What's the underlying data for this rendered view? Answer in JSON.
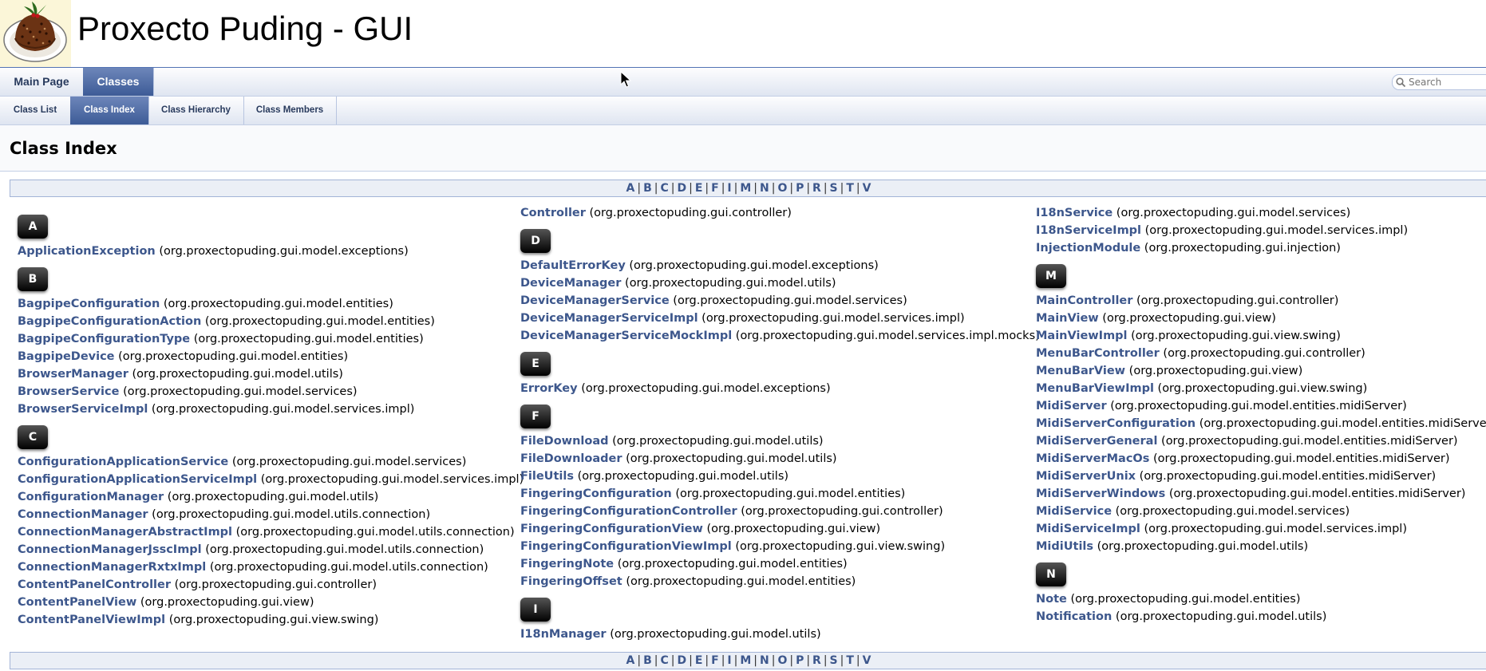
{
  "project": {
    "name": "Proxecto Puding - GUI"
  },
  "nav": {
    "tabs": [
      {
        "label": "Main Page",
        "active": false
      },
      {
        "label": "Classes",
        "active": true
      }
    ],
    "subtabs": [
      {
        "label": "Class List",
        "active": false
      },
      {
        "label": "Class Index",
        "active": true
      },
      {
        "label": "Class Hierarchy",
        "active": false
      },
      {
        "label": "Class Members",
        "active": false
      }
    ],
    "search_placeholder": "Search"
  },
  "page": {
    "title": "Class Index"
  },
  "letters_index": [
    "A",
    "B",
    "C",
    "D",
    "E",
    "F",
    "I",
    "M",
    "N",
    "O",
    "P",
    "R",
    "S",
    "T",
    "V"
  ],
  "columns": [
    [
      {
        "type": "letter",
        "text": "A"
      },
      {
        "type": "entry",
        "name": "ApplicationException",
        "pkg": "(org.proxectopuding.gui.model.exceptions)"
      },
      {
        "type": "letter",
        "text": "B"
      },
      {
        "type": "entry",
        "name": "BagpipeConfiguration",
        "pkg": "(org.proxectopuding.gui.model.entities)"
      },
      {
        "type": "entry",
        "name": "BagpipeConfigurationAction",
        "pkg": "(org.proxectopuding.gui.model.entities)"
      },
      {
        "type": "entry",
        "name": "BagpipeConfigurationType",
        "pkg": "(org.proxectopuding.gui.model.entities)"
      },
      {
        "type": "entry",
        "name": "BagpipeDevice",
        "pkg": "(org.proxectopuding.gui.model.entities)"
      },
      {
        "type": "entry",
        "name": "BrowserManager",
        "pkg": "(org.proxectopuding.gui.model.utils)"
      },
      {
        "type": "entry",
        "name": "BrowserService",
        "pkg": "(org.proxectopuding.gui.model.services)"
      },
      {
        "type": "entry",
        "name": "BrowserServiceImpl",
        "pkg": "(org.proxectopuding.gui.model.services.impl)"
      },
      {
        "type": "letter",
        "text": "C"
      },
      {
        "type": "entry",
        "name": "ConfigurationApplicationService",
        "pkg": "(org.proxectopuding.gui.model.services)"
      },
      {
        "type": "entry",
        "name": "ConfigurationApplicationServiceImpl",
        "pkg": "(org.proxectopuding.gui.model.services.impl)"
      },
      {
        "type": "entry",
        "name": "ConfigurationManager",
        "pkg": "(org.proxectopuding.gui.model.utils)"
      },
      {
        "type": "entry",
        "name": "ConnectionManager",
        "pkg": "(org.proxectopuding.gui.model.utils.connection)"
      },
      {
        "type": "entry",
        "name": "ConnectionManagerAbstractImpl",
        "pkg": "(org.proxectopuding.gui.model.utils.connection)"
      },
      {
        "type": "entry",
        "name": "ConnectionManagerJsscImpl",
        "pkg": "(org.proxectopuding.gui.model.utils.connection)"
      },
      {
        "type": "entry",
        "name": "ConnectionManagerRxtxImpl",
        "pkg": "(org.proxectopuding.gui.model.utils.connection)"
      },
      {
        "type": "entry",
        "name": "ContentPanelController",
        "pkg": "(org.proxectopuding.gui.controller)"
      },
      {
        "type": "entry",
        "name": "ContentPanelView",
        "pkg": "(org.proxectopuding.gui.view)"
      },
      {
        "type": "entry",
        "name": "ContentPanelViewImpl",
        "pkg": "(org.proxectopuding.gui.view.swing)"
      }
    ],
    [
      {
        "type": "entry",
        "name": "Controller",
        "pkg": "(org.proxectopuding.gui.controller)"
      },
      {
        "type": "letter",
        "text": "D"
      },
      {
        "type": "entry",
        "name": "DefaultErrorKey",
        "pkg": "(org.proxectopuding.gui.model.exceptions)"
      },
      {
        "type": "entry",
        "name": "DeviceManager",
        "pkg": "(org.proxectopuding.gui.model.utils)"
      },
      {
        "type": "entry",
        "name": "DeviceManagerService",
        "pkg": "(org.proxectopuding.gui.model.services)"
      },
      {
        "type": "entry",
        "name": "DeviceManagerServiceImpl",
        "pkg": "(org.proxectopuding.gui.model.services.impl)"
      },
      {
        "type": "entry",
        "name": "DeviceManagerServiceMockImpl",
        "pkg": "(org.proxectopuding.gui.model.services.impl.mocks)"
      },
      {
        "type": "letter",
        "text": "E"
      },
      {
        "type": "entry",
        "name": "ErrorKey",
        "pkg": "(org.proxectopuding.gui.model.exceptions)"
      },
      {
        "type": "letter",
        "text": "F"
      },
      {
        "type": "entry",
        "name": "FileDownload",
        "pkg": "(org.proxectopuding.gui.model.utils)"
      },
      {
        "type": "entry",
        "name": "FileDownloader",
        "pkg": "(org.proxectopuding.gui.model.utils)"
      },
      {
        "type": "entry",
        "name": "FileUtils",
        "pkg": "(org.proxectopuding.gui.model.utils)"
      },
      {
        "type": "entry",
        "name": "FingeringConfiguration",
        "pkg": "(org.proxectopuding.gui.model.entities)"
      },
      {
        "type": "entry",
        "name": "FingeringConfigurationController",
        "pkg": "(org.proxectopuding.gui.controller)"
      },
      {
        "type": "entry",
        "name": "FingeringConfigurationView",
        "pkg": "(org.proxectopuding.gui.view)"
      },
      {
        "type": "entry",
        "name": "FingeringConfigurationViewImpl",
        "pkg": "(org.proxectopuding.gui.view.swing)"
      },
      {
        "type": "entry",
        "name": "FingeringNote",
        "pkg": "(org.proxectopuding.gui.model.entities)"
      },
      {
        "type": "entry",
        "name": "FingeringOffset",
        "pkg": "(org.proxectopuding.gui.model.entities)"
      },
      {
        "type": "letter",
        "text": "I"
      },
      {
        "type": "entry",
        "name": "I18nManager",
        "pkg": "(org.proxectopuding.gui.model.utils)"
      }
    ],
    [
      {
        "type": "entry",
        "name": "I18nService",
        "pkg": "(org.proxectopuding.gui.model.services)"
      },
      {
        "type": "entry",
        "name": "I18nServiceImpl",
        "pkg": "(org.proxectopuding.gui.model.services.impl)"
      },
      {
        "type": "entry",
        "name": "InjectionModule",
        "pkg": "(org.proxectopuding.gui.injection)"
      },
      {
        "type": "letter",
        "text": "M"
      },
      {
        "type": "entry",
        "name": "MainController",
        "pkg": "(org.proxectopuding.gui.controller)"
      },
      {
        "type": "entry",
        "name": "MainView",
        "pkg": "(org.proxectopuding.gui.view)"
      },
      {
        "type": "entry",
        "name": "MainViewImpl",
        "pkg": "(org.proxectopuding.gui.view.swing)"
      },
      {
        "type": "entry",
        "name": "MenuBarController",
        "pkg": "(org.proxectopuding.gui.controller)"
      },
      {
        "type": "entry",
        "name": "MenuBarView",
        "pkg": "(org.proxectopuding.gui.view)"
      },
      {
        "type": "entry",
        "name": "MenuBarViewImpl",
        "pkg": "(org.proxectopuding.gui.view.swing)"
      },
      {
        "type": "entry",
        "name": "MidiServer",
        "pkg": "(org.proxectopuding.gui.model.entities.midiServer)"
      },
      {
        "type": "entry",
        "name": "MidiServerConfiguration",
        "pkg": "(org.proxectopuding.gui.model.entities.midiServer)"
      },
      {
        "type": "entry",
        "name": "MidiServerGeneral",
        "pkg": "(org.proxectopuding.gui.model.entities.midiServer)"
      },
      {
        "type": "entry",
        "name": "MidiServerMacOs",
        "pkg": "(org.proxectopuding.gui.model.entities.midiServer)"
      },
      {
        "type": "entry",
        "name": "MidiServerUnix",
        "pkg": "(org.proxectopuding.gui.model.entities.midiServer)"
      },
      {
        "type": "entry",
        "name": "MidiServerWindows",
        "pkg": "(org.proxectopuding.gui.model.entities.midiServer)"
      },
      {
        "type": "entry",
        "name": "MidiService",
        "pkg": "(org.proxectopuding.gui.model.services)"
      },
      {
        "type": "entry",
        "name": "MidiServiceImpl",
        "pkg": "(org.proxectopuding.gui.model.services.impl)"
      },
      {
        "type": "entry",
        "name": "MidiUtils",
        "pkg": "(org.proxectopuding.gui.model.utils)"
      },
      {
        "type": "letter",
        "text": "N"
      },
      {
        "type": "entry",
        "name": "Note",
        "pkg": "(org.proxectopuding.gui.model.entities)"
      },
      {
        "type": "entry",
        "name": "Notification",
        "pkg": "(org.proxectopuding.gui.model.utils)"
      }
    ]
  ]
}
